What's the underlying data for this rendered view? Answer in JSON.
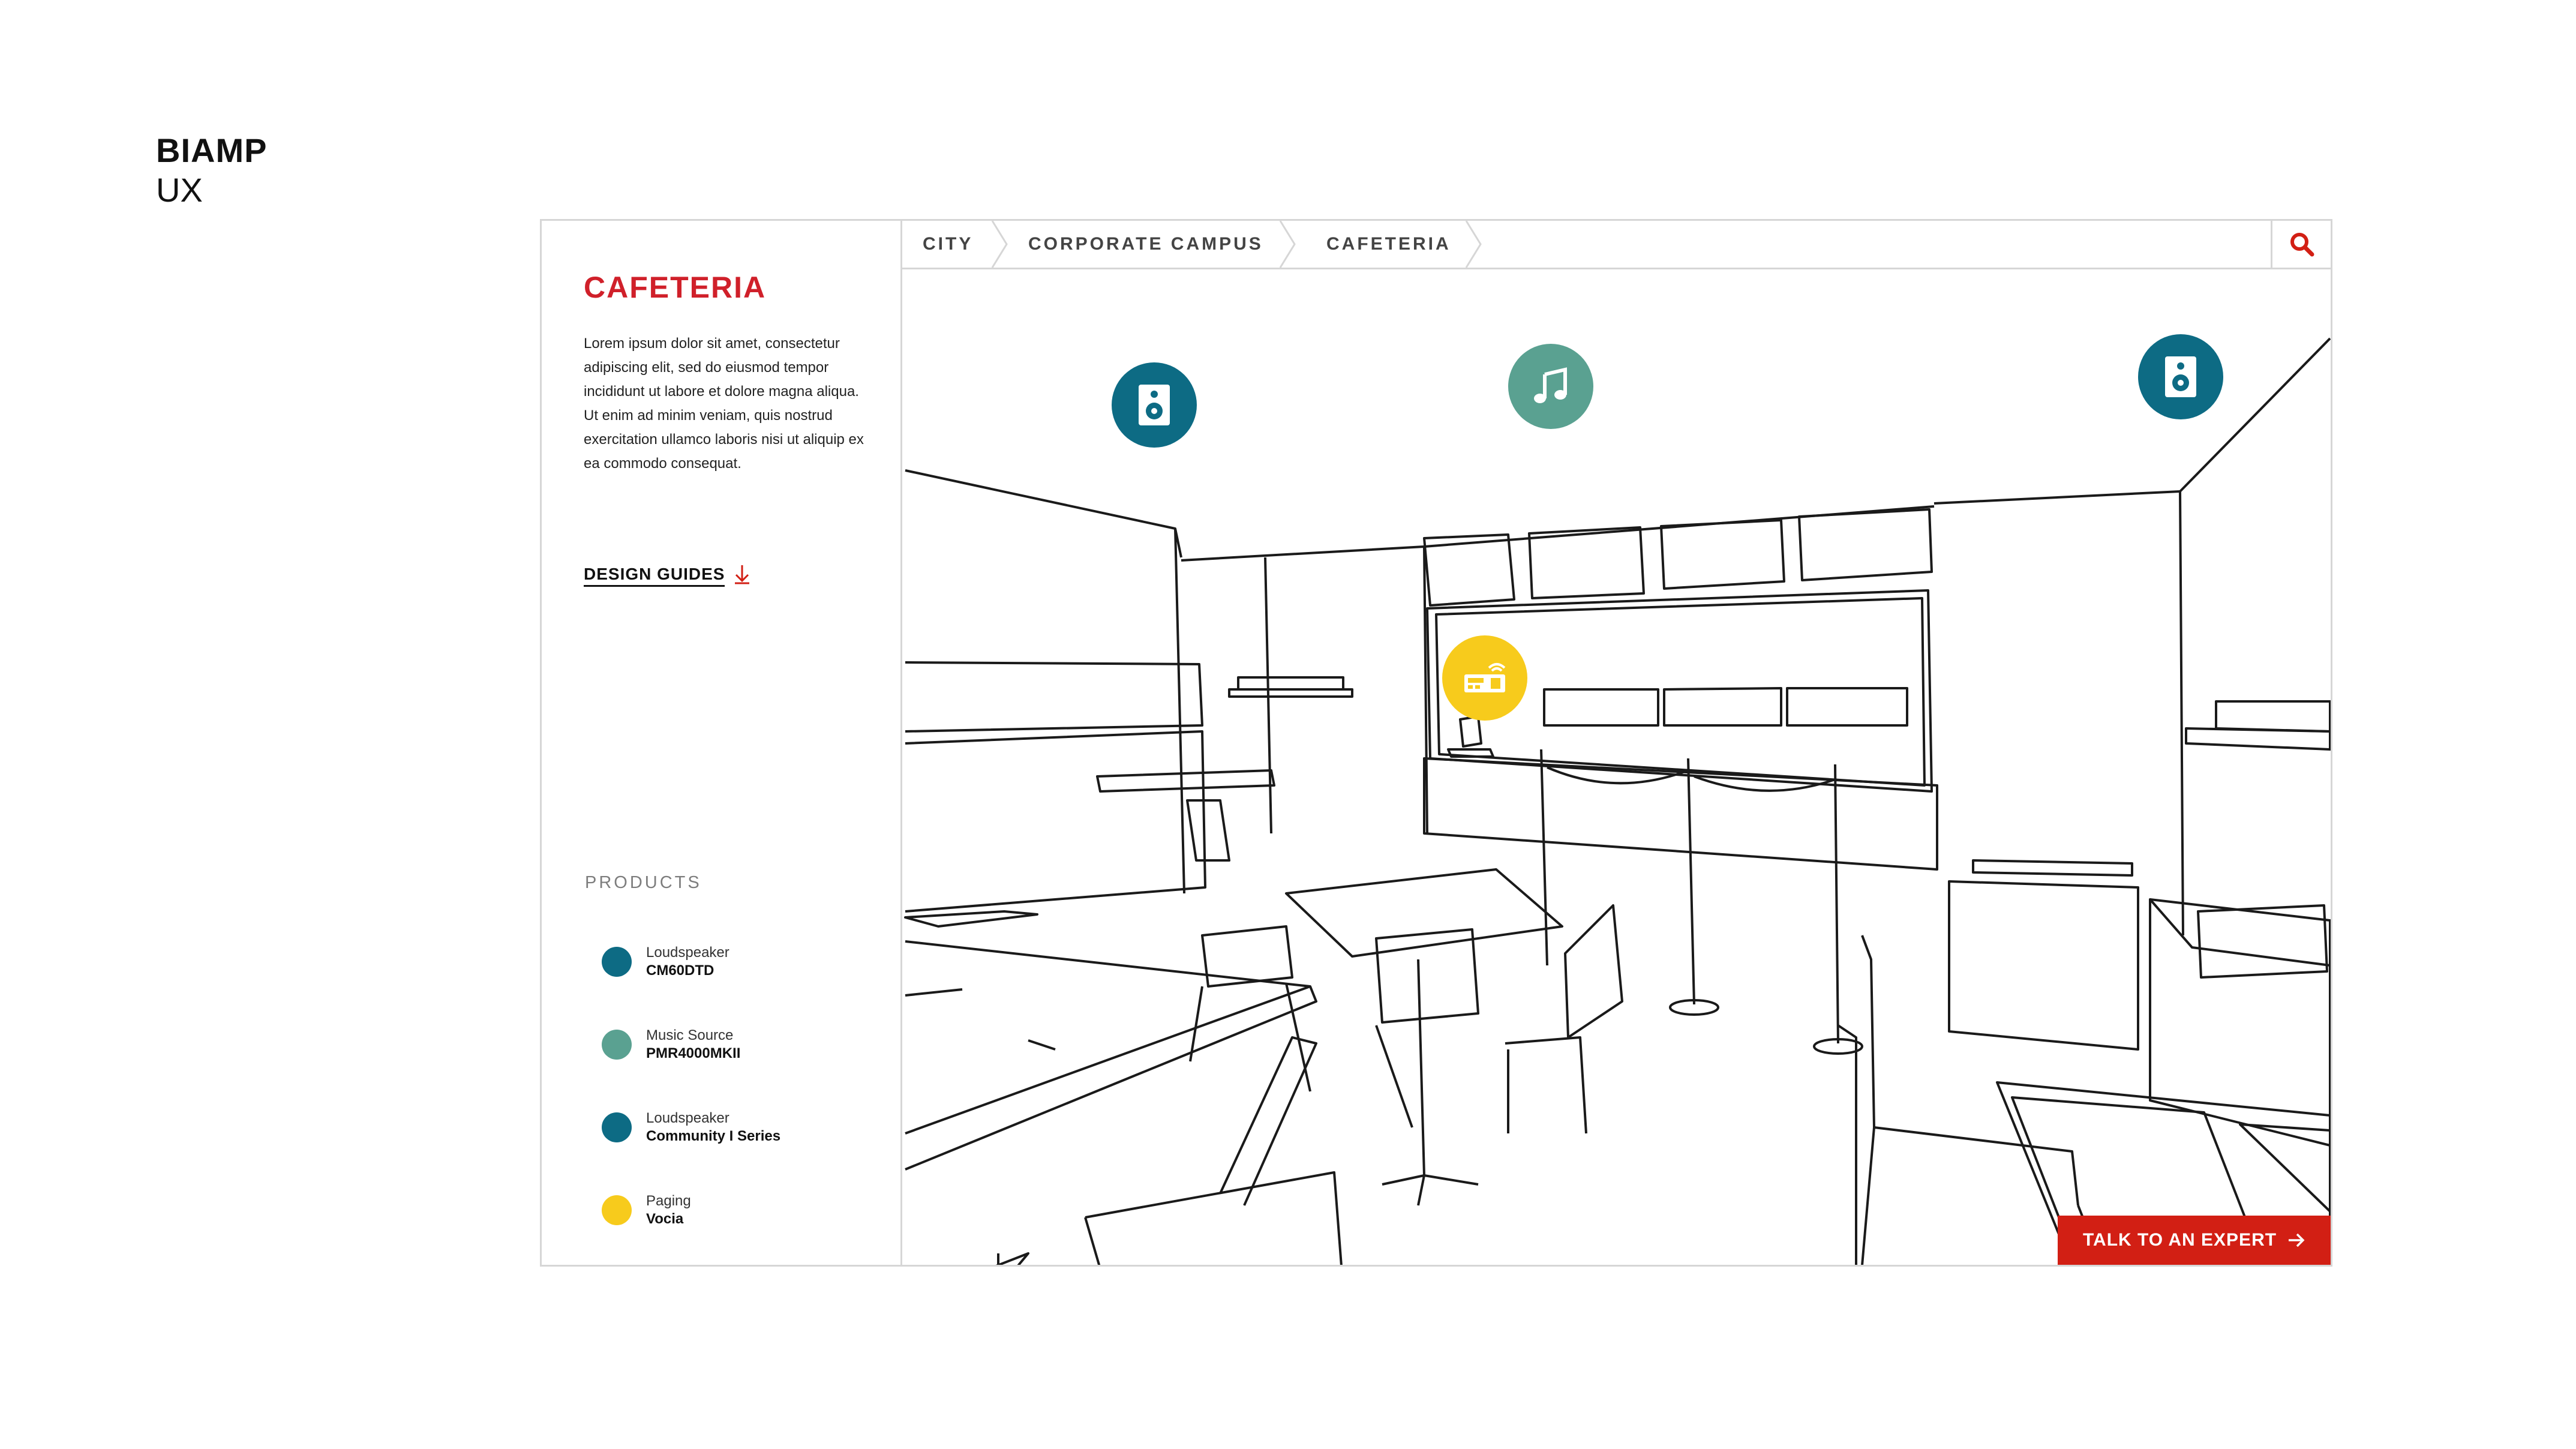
{
  "brand": {
    "name": "BIAMP",
    "subtitle": "UX"
  },
  "sidebar": {
    "title": "CAFETERIA",
    "description": "Lorem ipsum dolor sit amet, consectetur adipiscing elit, sed do eiusmod tempor incididunt ut labore et dolore magna aliqua. Ut enim ad minim veniam, quis nostrud exercitation ullamco laboris nisi ut aliquip ex ea commodo consequat.",
    "design_guides_label": "DESIGN GUIDES",
    "products_title": "PRODUCTS",
    "products": [
      {
        "type": "Loudspeaker",
        "model": "CM60DTD",
        "color": "#0d6b84"
      },
      {
        "type": "Music Source",
        "model": "PMR4000MKII",
        "color": "#5aa191"
      },
      {
        "type": "Loudspeaker",
        "model": "Community I Series",
        "color": "#0d6b84"
      },
      {
        "type": "Paging",
        "model": "Vocia",
        "color": "#f7cb1c"
      }
    ]
  },
  "breadcrumb": [
    "CITY",
    "CORPORATE CAMPUS",
    "CAFETERIA"
  ],
  "hotspots": [
    {
      "icon": "speaker-icon",
      "color": "#0d6b84"
    },
    {
      "icon": "music-note-icon",
      "color": "#5aa191"
    },
    {
      "icon": "speaker-icon",
      "color": "#0d6b84"
    },
    {
      "icon": "paging-station-icon",
      "color": "#f7cb1c"
    }
  ],
  "cta": {
    "label": "TALK TO AN EXPERT"
  },
  "colors": {
    "accent": "#d21f14",
    "title_red": "#d0202a",
    "border": "#d6d6d6"
  }
}
